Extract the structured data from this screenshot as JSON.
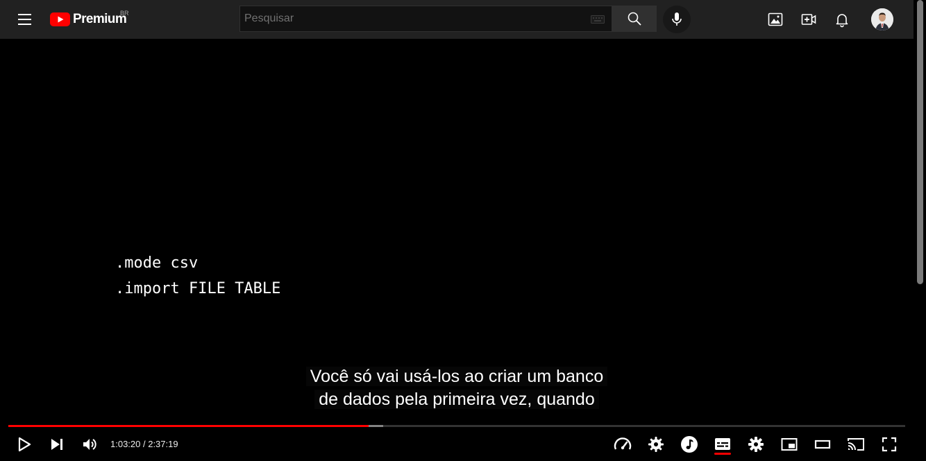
{
  "header": {
    "logo_text": "Premium",
    "country_code": "BR",
    "search_placeholder": "Pesquisar"
  },
  "video": {
    "code_lines": [
      ".mode csv",
      ".import FILE TABLE"
    ],
    "caption_lines": [
      "Você só vai usá-los ao criar um banco",
      "de dados pela primeira vez, quando"
    ]
  },
  "player": {
    "time_display": "1:03:20 / 2:37:19",
    "played_fraction": 0.402,
    "buffered_fraction": 0.418
  },
  "colors": {
    "accent": "#ff0000",
    "topbar_bg": "#212121"
  },
  "icons": {
    "top_right": [
      "image-icon",
      "create-video-icon",
      "notifications-bell-icon",
      "avatar"
    ],
    "controls_left": [
      "play-icon",
      "next-icon",
      "volume-icon"
    ],
    "controls_right": [
      "playback-speed-icon",
      "settings-gear-icon",
      "music-note-icon",
      "subtitles-icon",
      "settings-icon",
      "miniplayer-icon",
      "theater-mode-icon",
      "cast-icon",
      "fullscreen-icon"
    ]
  }
}
